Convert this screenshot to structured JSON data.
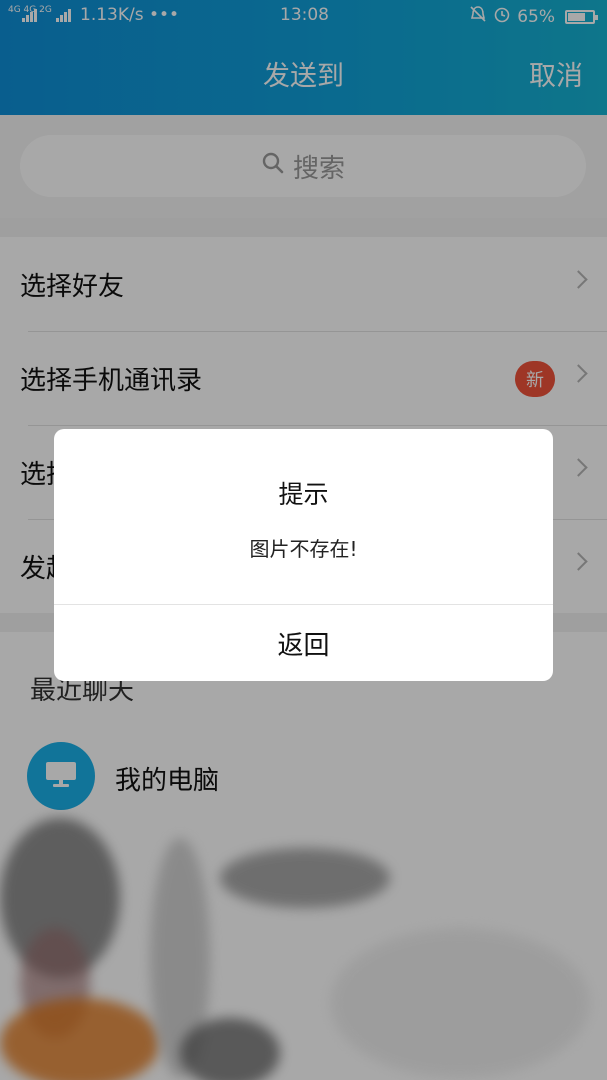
{
  "status_bar": {
    "network_labels": "4G 4G 2G",
    "speed": "1.13K/s",
    "more": "•••",
    "time": "13:08",
    "battery": "65%",
    "battery_level": 0.65
  },
  "header": {
    "title": "发送到",
    "cancel": "取消"
  },
  "search": {
    "placeholder": "搜索"
  },
  "list": {
    "items": [
      {
        "label": "选择好友"
      },
      {
        "label": "选择手机通讯录",
        "badge": "新"
      },
      {
        "label": "选择群聊"
      },
      {
        "label": "发起群聊"
      }
    ]
  },
  "recent": {
    "title": "最近聊天",
    "items": [
      {
        "label": "我的电脑"
      }
    ]
  },
  "dialog": {
    "title": "提示",
    "message": "图片不存在!",
    "button": "返回"
  },
  "colors": {
    "header_gradient_start": "#0f8fd8",
    "header_gradient_end": "#16b3d3",
    "badge": "#f0533b",
    "avatar": "#1ab0e8"
  },
  "icons": [
    "search-icon",
    "chevron-right-icon",
    "computer-icon",
    "alarm-icon",
    "bell-off-icon",
    "battery-icon",
    "signal-icon"
  ]
}
